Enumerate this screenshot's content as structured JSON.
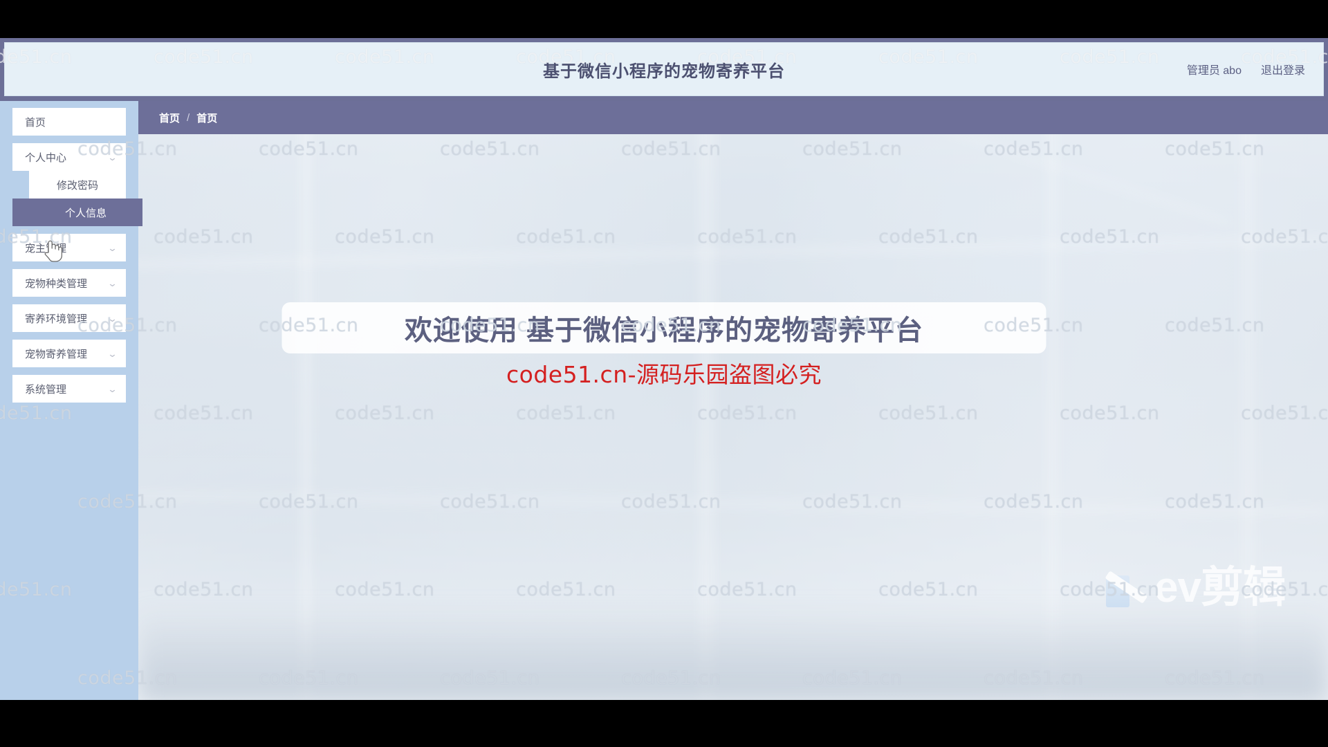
{
  "window": {
    "app_title": "基于微信小程序的宠物寄养平台"
  },
  "header": {
    "title": "基于微信小程序的宠物寄养平台",
    "user_label": "管理员 abo",
    "logout_label": "退出登录",
    "background_color": "#e6f0f7",
    "band_color": "#6c6f97",
    "title_color": "#4c5070"
  },
  "breadcrumb": {
    "home_label": "首页",
    "separator": "/",
    "current_label": "首页",
    "background_color": "#6d6f99"
  },
  "sidebar": {
    "background_color": "#b8d0ea",
    "active_color": "#6d6f99",
    "items": [
      {
        "label": "首页",
        "icon": "home-icon",
        "expandable": false,
        "chevron": ""
      },
      {
        "label": "个人中心",
        "icon": "user-icon",
        "expandable": true,
        "chevron": "⌄"
      },
      {
        "label": "宠主管理",
        "icon": "owner-icon",
        "expandable": true,
        "chevron": "⌄"
      },
      {
        "label": "宠物种类管理",
        "icon": "category-icon",
        "expandable": true,
        "chevron": "⌄"
      },
      {
        "label": "寄养环境管理",
        "icon": "environment-icon",
        "expandable": true,
        "chevron": "⌄"
      },
      {
        "label": "宠物寄养管理",
        "icon": "boarding-icon",
        "expandable": true,
        "chevron": "⌄"
      },
      {
        "label": "系统管理",
        "icon": "settings-icon",
        "expandable": true,
        "chevron": "⌄"
      }
    ],
    "submenu": {
      "parent": "个人中心",
      "items": [
        {
          "label": "修改密码",
          "active": false
        },
        {
          "label": "个人信息",
          "active": true
        }
      ]
    }
  },
  "main": {
    "welcome_text": "欢迎使用 基于微信小程序的宠物寄养平台",
    "welcome_text_color": "#5c6080",
    "notice_text": "code51.cn-源码乐园盗图必究",
    "notice_color": "#d42020"
  },
  "watermark": {
    "text": "code51.cn",
    "color": "rgba(255,255,255,0.62)"
  },
  "overlay": {
    "recorder_logo_text": "ev剪辑"
  }
}
